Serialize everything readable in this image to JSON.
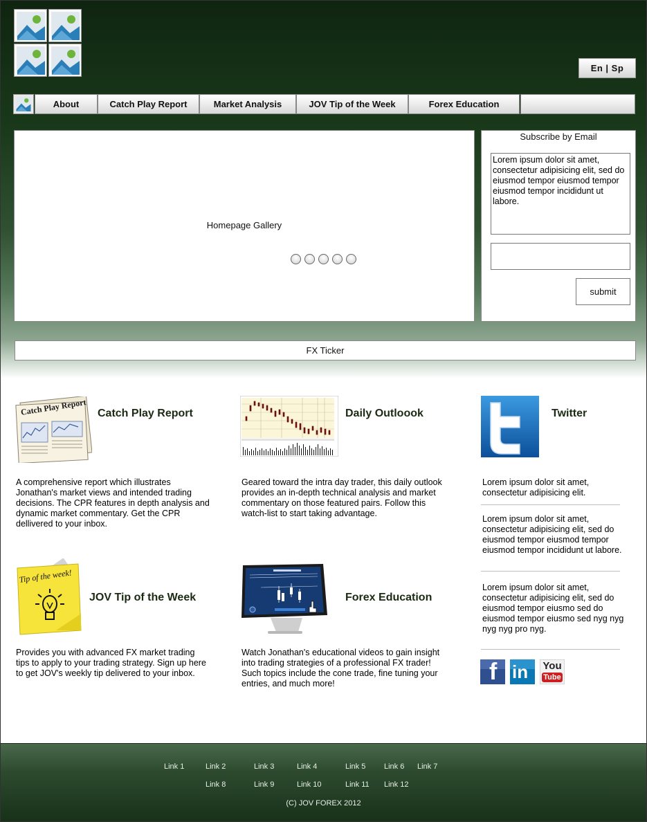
{
  "header": {
    "language_toggle": "En | Sp"
  },
  "nav": {
    "items": [
      {
        "label": "About"
      },
      {
        "label": "Catch Play Report"
      },
      {
        "label": "Market Analysis"
      },
      {
        "label": "JOV Tip of the Week"
      },
      {
        "label": "Forex Education"
      },
      {
        "label": ""
      }
    ]
  },
  "gallery": {
    "label": "Homepage Gallery",
    "slide_count": 5
  },
  "subscribe": {
    "title": "Subscribe by Email",
    "text": "Lorem ipsum dolor sit amet, consectetur adipisicing elit, sed do eiusmod tempor eiusmod tempor eiusmod tempor incididunt ut labore.",
    "email_value": "",
    "submit_label": "submit"
  },
  "ticker": {
    "label": "FX Ticker"
  },
  "cards": {
    "catch_play": {
      "title": "Catch Play Report",
      "thumb_text": "Catch Play Report",
      "text": "A comprehensive report which illustrates Jonathan's market views and intended trading decisions. The CPR features in depth analysis and dynamic market commentary. Get the CPR dellivered to your inbox."
    },
    "daily_outlook": {
      "title": "Daily Outloook",
      "text": "Geared toward the intra day trader, this daily outlook provides an in-depth technical analysis and market commentary on those featured pairs. Follow this watch-list to start taking advantage."
    },
    "jov_tip": {
      "title": "JOV Tip of the Week",
      "thumb_text": "Tip of the week!",
      "text": "Provides you with advanced FX market trading tips to apply to your trading strategy. Sign up here to get JOV's weekly tip delivered to your inbox."
    },
    "forex_education": {
      "title": "Forex Education",
      "text": "Watch Jonathan's educational videos to gain insight into trading strategies of a professional FX trader! Such topics include the cone trade, fine tuning your entries, and much more!"
    }
  },
  "twitter": {
    "title": "Twitter",
    "posts": [
      "Lorem ipsum dolor sit amet, consectetur adipisicing elit.",
      "Lorem ipsum dolor sit amet, consectetur adipisicing elit, sed do eiusmod tempor eiusmod tempor eiusmod tempor incididunt ut labore.",
      "Lorem ipsum dolor sit amet, consectetur adipisicing elit, sed do eiusmod tempor eiusmo sed do eiusmod tempor eiusmo sed nyg nyg nyg nyg pro nyg."
    ]
  },
  "social": {
    "facebook": "f",
    "linkedin": "in",
    "youtube_top": "You",
    "youtube_bottom": "Tube"
  },
  "footer": {
    "links": [
      "Link 1",
      "Link 2",
      "Link 3",
      "Link 4",
      "Link 5",
      "Link 6",
      "Link 7",
      "Link 8",
      "Link 9",
      "Link 10",
      "Link 11",
      "Link 12"
    ],
    "copyright": "(C) JOV FOREX 2012"
  },
  "colors": {
    "header_dark_green": "#0f2410",
    "accent_title_green": "#1b2a12",
    "twitter_blue": "#1d6fc0",
    "facebook_blue": "#2f4f8f",
    "linkedin_blue": "#0b78b6",
    "youtube_red": "#cc1f1f"
  }
}
